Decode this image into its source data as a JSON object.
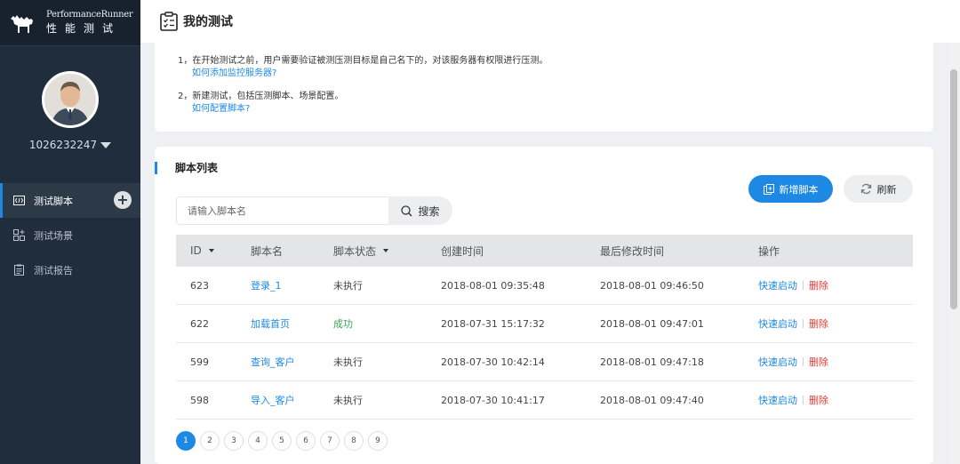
{
  "brand": {
    "name_en": "PerformanceRunner",
    "name_cn": "性能测试"
  },
  "user": {
    "name": "1026232247"
  },
  "menu": [
    {
      "label": "测试脚本",
      "icon": "code-icon",
      "active": true
    },
    {
      "label": "测试场景",
      "icon": "scene-icon",
      "active": false
    },
    {
      "label": "测试报告",
      "icon": "report-icon",
      "active": false
    }
  ],
  "page": {
    "title": "我的测试"
  },
  "tips": {
    "line1": "1，在开始测试之前，用户需要验证被测压测目标是自己名下的，对该服务器有权限进行压测。",
    "link1": "如何添加监控服务器?",
    "line2": "2，新建测试，包括压测脚本、场景配置。",
    "link2": "如何配置脚本?"
  },
  "panel": {
    "title": "脚本列表",
    "search_placeholder": "请输入脚本名",
    "search_label": "搜索",
    "add_label": "新增脚本",
    "refresh_label": "刷新"
  },
  "table": {
    "headers": {
      "id": "ID",
      "name": "脚本名",
      "status": "脚本状态",
      "created": "创建时间",
      "modified": "最后修改时间",
      "actions": "操作"
    },
    "rows": [
      {
        "id": "623",
        "name": "登录_1",
        "status": "未执行",
        "created": "2018-08-01 09:35:48",
        "modified": "2018-08-01 09:46:50",
        "start": "快速启动",
        "delete": "删除"
      },
      {
        "id": "622",
        "name": "加载首页",
        "status": "成功",
        "created": "2018-07-31 15:17:32",
        "modified": "2018-08-01 09:47:01",
        "start": "快速启动",
        "delete": "删除"
      },
      {
        "id": "599",
        "name": "查询_客户",
        "status": "未执行",
        "created": "2018-07-30 10:42:14",
        "modified": "2018-08-01 09:47:18",
        "start": "快速启动",
        "delete": "删除"
      },
      {
        "id": "598",
        "name": "导入_客户",
        "status": "未执行",
        "created": "2018-07-30 10:41:17",
        "modified": "2018-08-01 09:47:40",
        "start": "快速启动",
        "delete": "删除"
      }
    ]
  },
  "pagination": {
    "pages": [
      "1",
      "2",
      "3",
      "4",
      "5",
      "6",
      "7",
      "8",
      "9"
    ],
    "current": "1"
  },
  "colors": {
    "accent": "#1e88e5",
    "sidebar": "#1f2d3d",
    "success": "#3aa655",
    "danger": "#e53935"
  }
}
